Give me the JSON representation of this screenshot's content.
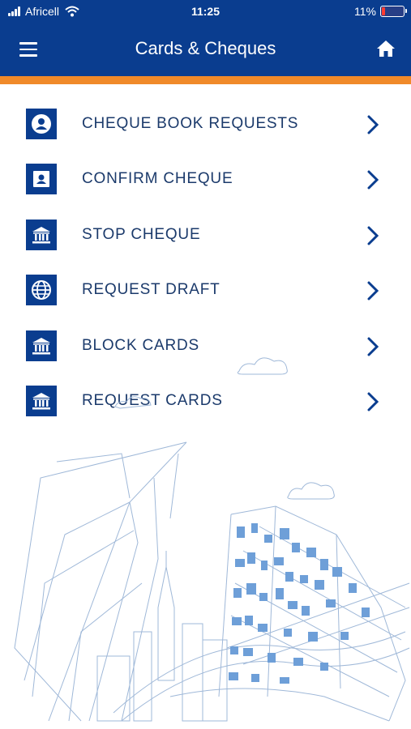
{
  "status_bar": {
    "carrier": "Africell",
    "time": "11:25",
    "battery": "11%",
    "battery_level": 0.11
  },
  "header": {
    "title": "Cards & Cheques",
    "menu_icon": "hamburger-menu-icon",
    "home_icon": "home-icon"
  },
  "colors": {
    "primary": "#0a3d8f",
    "accent": "#f08a2a",
    "text": "#1b3a6b"
  },
  "menu": {
    "items": [
      {
        "label": "CHEQUE BOOK REQUESTS",
        "icon": "user-circle-icon"
      },
      {
        "label": "CONFIRM CHEQUE",
        "icon": "id-card-icon"
      },
      {
        "label": "STOP CHEQUE",
        "icon": "bank-icon"
      },
      {
        "label": "REQUEST DRAFT",
        "icon": "globe-icon"
      },
      {
        "label": "BLOCK CARDS",
        "icon": "bank-icon"
      },
      {
        "label": "REQUEST CARDS",
        "icon": "bank-icon"
      }
    ]
  }
}
